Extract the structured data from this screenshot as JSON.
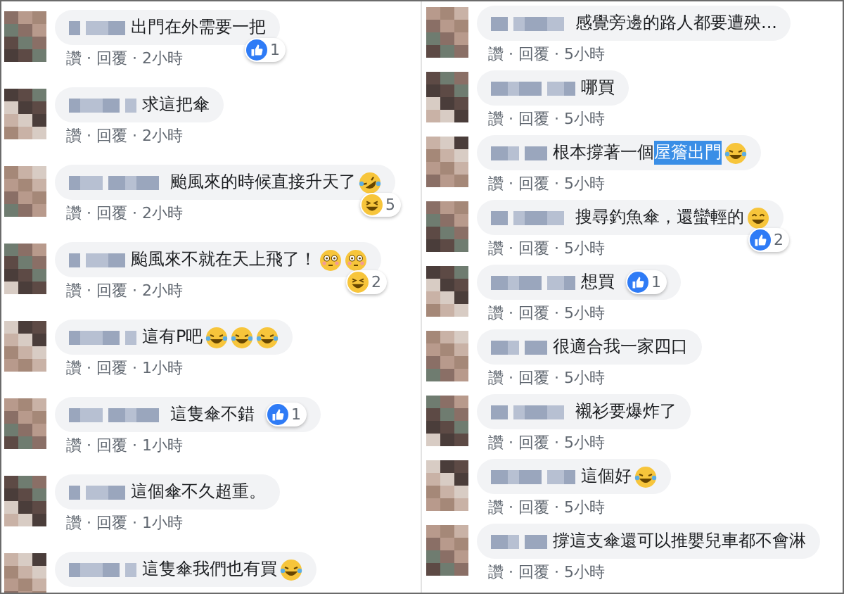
{
  "columns": [
    {
      "comments": [
        {
          "text": "出門在外需要一把",
          "meta": "讚 · 回覆 · 2小時",
          "reactions": [
            {
              "kind": "like",
              "count": "1"
            }
          ]
        },
        {
          "text": "求這把傘",
          "meta": "讚 · 回覆 · 2小時"
        },
        {
          "text": "颱風來的時候直接升天了",
          "emojis": [
            {
              "kind": "rofl"
            }
          ],
          "meta": "讚 · 回覆 · 2小時",
          "reactions": [
            {
              "kind": "haha",
              "count": "5"
            }
          ]
        },
        {
          "text": "颱風來不就在天上飛了！",
          "emojis": [
            {
              "kind": "flushed"
            },
            {
              "kind": "flushed"
            }
          ],
          "meta": "讚 · 回覆 · 2小時",
          "reactions": [
            {
              "kind": "haha",
              "count": "2"
            }
          ]
        },
        {
          "text": "這有P吧",
          "emojis": [
            {
              "kind": "laugh"
            },
            {
              "kind": "laugh"
            },
            {
              "kind": "laugh"
            }
          ],
          "meta": "讚 · 回覆 · 1小時"
        },
        {
          "text": "這隻傘不錯",
          "meta": "讚 · 回覆 · 1小時",
          "reactions": [
            {
              "kind": "like",
              "count": "1"
            }
          ]
        },
        {
          "text": "這個傘不久超重。",
          "meta": "讚 · 回覆 · 1小時"
        },
        {
          "text": "這隻傘我們也有買",
          "emojis": [
            {
              "kind": "laugh"
            }
          ]
        }
      ]
    },
    {
      "comments": [
        {
          "text": "感覺旁邊的路人都要遭殃...",
          "meta": "讚 · 回覆 · 5小時"
        },
        {
          "text": "哪買",
          "meta": "讚 · 回覆 · 5小時"
        },
        {
          "text": "根本撐著一個",
          "highlight": "屋簷出門",
          "emojis": [
            {
              "kind": "laugh"
            }
          ],
          "meta": "讚 · 回覆 · 5小時"
        },
        {
          "text": "搜尋釣魚傘，還蠻輕的",
          "emojis": [
            {
              "kind": "grin"
            }
          ],
          "meta": "讚 · 回覆 · 5小時",
          "reactions": [
            {
              "kind": "like",
              "count": "2"
            }
          ]
        },
        {
          "text": "想買",
          "meta": "讚 · 回覆 · 5小時",
          "reactions": [
            {
              "kind": "like",
              "count": "1"
            }
          ]
        },
        {
          "text": "很適合我一家四口",
          "meta": "讚 · 回覆 · 5小時"
        },
        {
          "text": "襯衫要爆炸了",
          "meta": "讚 · 回覆 · 5小時"
        },
        {
          "text": "這個好",
          "emojis": [
            {
              "kind": "laugh"
            }
          ],
          "meta": "讚 · 回覆 · 5小時"
        },
        {
          "text": "撐這支傘還可以推嬰兒車都不會淋",
          "meta": "讚 · 回覆 · 5小時"
        }
      ]
    }
  ]
}
